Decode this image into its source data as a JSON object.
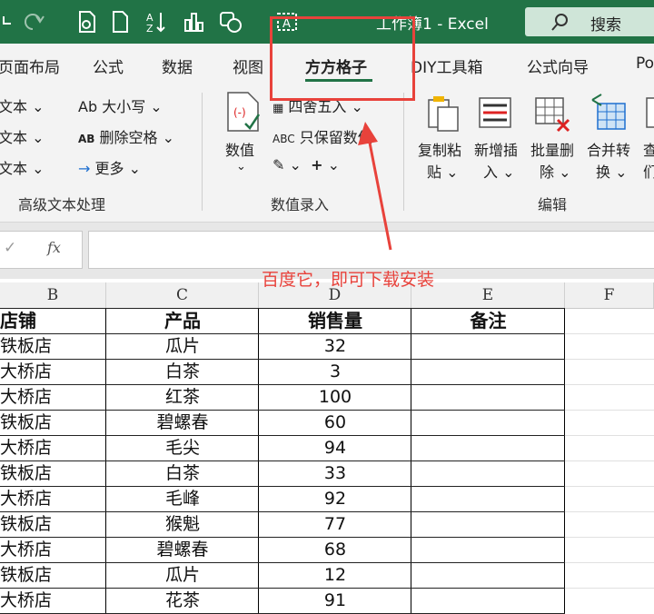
{
  "titlebar": {
    "title": "工作簿1 - Excel",
    "search_label": "搜索",
    "icons": [
      "undo-icon",
      "redo-icon",
      "file-icon",
      "new-file-icon",
      "sort-icon",
      "chart-icon",
      "shapes-icon",
      "text-box-icon",
      "search-icon"
    ]
  },
  "tabs": [
    "页面布局",
    "公式",
    "数据",
    "视图",
    "方方格子",
    "DIY工具箱",
    "公式向导",
    "Po"
  ],
  "active_tab": "方方格子",
  "ribbon": {
    "text_group": {
      "items": [
        "文本",
        "文本",
        "文本"
      ],
      "case_label": "Ab 大小写",
      "remove_space_label": "删除空格",
      "more_label": "更多",
      "group_label": "高级文本处理"
    },
    "number_group": {
      "value_label": "数值",
      "round_label": "四舍五入",
      "keep_label": "只保留数值",
      "group_label": "数值录入"
    },
    "edit_group": {
      "buttons": [
        {
          "line1": "复制粘",
          "line2": "贴"
        },
        {
          "line1": "新增插",
          "line2": "入"
        },
        {
          "line1": "批量删",
          "line2": "除"
        },
        {
          "line1": "合并转",
          "line2": "换"
        },
        {
          "line1": "查",
          "line2": "们"
        }
      ],
      "group_label": "编辑"
    }
  },
  "formula_bar": {
    "fx": "fx",
    "value": ""
  },
  "annotation": {
    "text": "百度它，即可下载安装",
    "color": "#e8423b"
  },
  "sheet": {
    "columns": [
      "B",
      "C",
      "D",
      "E",
      "F"
    ],
    "header": [
      "店铺",
      "产品",
      "销售量",
      "备注"
    ],
    "rows": [
      [
        "铁板店",
        "瓜片",
        "32",
        ""
      ],
      [
        "大桥店",
        "白茶",
        "3",
        ""
      ],
      [
        "大桥店",
        "红茶",
        "100",
        ""
      ],
      [
        "铁板店",
        "碧螺春",
        "60",
        ""
      ],
      [
        "大桥店",
        "毛尖",
        "94",
        ""
      ],
      [
        "铁板店",
        "白茶",
        "33",
        ""
      ],
      [
        "大桥店",
        "毛峰",
        "92",
        ""
      ],
      [
        "铁板店",
        "猴魁",
        "77",
        ""
      ],
      [
        "大桥店",
        "碧螺春",
        "68",
        ""
      ],
      [
        "铁板店",
        "瓜片",
        "12",
        ""
      ],
      [
        "大桥店",
        "花茶",
        "91",
        ""
      ]
    ]
  },
  "colors": {
    "excel_green": "#217346",
    "ribbon_bg": "#f3f3f3"
  }
}
